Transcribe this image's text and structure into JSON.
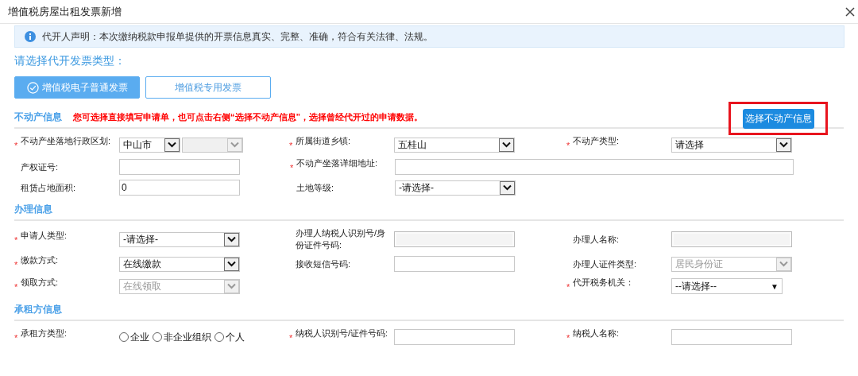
{
  "window": {
    "title": "增值税房屋出租发票新增"
  },
  "notice": "代开人声明：本次缴纳税款申报单提供的开票信息真实、完整、准确，符合有关法律、法规。",
  "invoice_type": {
    "prompt": "请选择代开发票类型：",
    "options": [
      {
        "label": "增值税电子普通发票",
        "selected": true
      },
      {
        "label": "增值税专用发票",
        "selected": false
      }
    ]
  },
  "sections": [
    {
      "title": "不动产信息",
      "hint": "您可选择直接填写申请单，也可点击右侧“选择不动产信息”，选择曾经代开过的申请数据。",
      "action": {
        "label": "选择不动产信息",
        "highlighted": true
      },
      "rows": [
        [
          {
            "required_mark": "*",
            "label": "不动产坐落地行政区划:",
            "controls": [
              {
                "kind": "select",
                "value": "中山市",
                "disabled": false
              },
              {
                "kind": "select",
                "disabled": true
              }
            ]
          },
          {
            "required_mark": "*",
            "label": "所属街道乡镇:",
            "controls": [
              {
                "kind": "select",
                "value": "五桂山",
                "disabled": false
              }
            ]
          },
          {
            "required_mark": "*",
            "label": "不动产类型:",
            "controls": [
              {
                "kind": "select",
                "value": "请选择",
                "disabled": false
              }
            ]
          }
        ],
        [
          {
            "label": "产权证号:",
            "controls": [
              {
                "kind": "input",
                "disabled": false
              }
            ]
          },
          {
            "required_mark": "*",
            "label": "不动产坐落详细地址:",
            "controls": [
              {
                "kind": "input",
                "disabled": false
              }
            ]
          }
        ],
        [
          {
            "label": "租赁占地面积:",
            "controls": [
              {
                "kind": "input",
                "value": "0",
                "disabled": false
              }
            ]
          },
          {
            "label": "土地等级:",
            "controls": [
              {
                "kind": "select",
                "value": "-请选择-",
                "disabled": false
              }
            ]
          }
        ]
      ]
    },
    {
      "title": "办理信息",
      "rows": [
        [
          {
            "required_mark": "*",
            "label": "申请人类型:",
            "controls": [
              {
                "kind": "select",
                "value": "-请选择-",
                "disabled": false
              }
            ]
          },
          {
            "label": "办理人纳税人识别号/身份证件号码:",
            "controls": [
              {
                "kind": "input",
                "disabled": true
              }
            ]
          },
          {
            "label": "办理人名称:",
            "controls": [
              {
                "kind": "input",
                "disabled": true
              }
            ]
          }
        ],
        [
          {
            "required_mark": "*",
            "label": "缴款方式:",
            "controls": [
              {
                "kind": "select",
                "value": "在线缴款",
                "disabled": false
              }
            ]
          },
          {
            "label": "接收短信号码:",
            "controls": [
              {
                "kind": "input",
                "disabled": false
              }
            ]
          },
          {
            "label": "办理人证件类型:",
            "controls": [
              {
                "kind": "select",
                "value": "居民身份证",
                "disabled": true
              }
            ]
          }
        ],
        [
          {
            "required_mark": "*",
            "label": "领取方式:",
            "controls": [
              {
                "kind": "select",
                "value": "在线领取",
                "disabled": true
              }
            ]
          },
          null,
          {
            "required_mark": "*",
            "label": "代开税务机关：",
            "controls": [
              {
                "kind": "dropdown",
                "value": "--请选择--",
                "arrow": "▼",
                "disabled": false
              }
            ]
          }
        ]
      ]
    },
    {
      "title": "承租方信息",
      "rows": [
        [
          {
            "required_mark": "*",
            "label": "承租方类型:",
            "controls": [
              {
                "kind": "radio",
                "options": [
                  {
                    "label": "企业",
                    "selected": false
                  },
                  {
                    "label": "非企业组织",
                    "selected": false
                  },
                  {
                    "label": "个人",
                    "selected": false
                  }
                ]
              }
            ]
          },
          {
            "required_mark": "*",
            "label": "纳税人识别号/证件号码:",
            "controls": [
              {
                "kind": "input",
                "disabled": false
              }
            ]
          },
          {
            "required_mark": "*",
            "label": "纳税人名称:",
            "controls": [
              {
                "kind": "input",
                "disabled": false
              }
            ]
          }
        ]
      ]
    }
  ]
}
